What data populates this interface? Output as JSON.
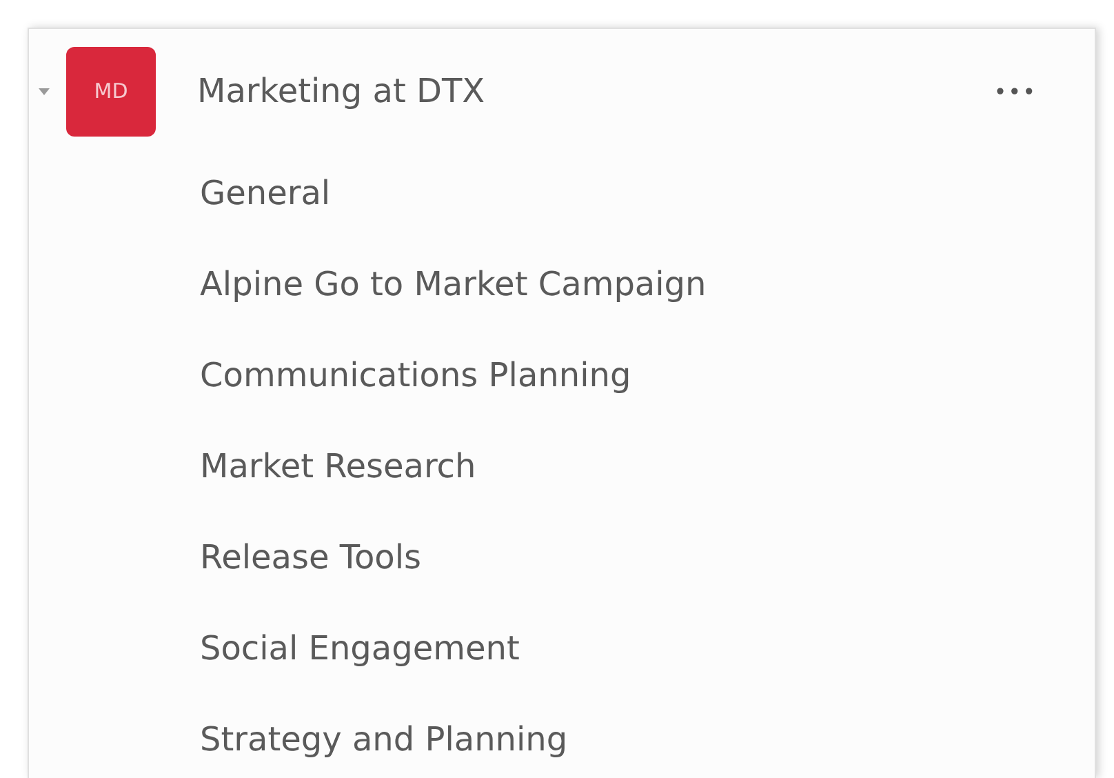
{
  "team": {
    "initials": "MD",
    "name": "Marketing at DTX",
    "expanded": true,
    "more": "•••",
    "color": "#d9283c"
  },
  "channels": [
    {
      "name": "General"
    },
    {
      "name": "Alpine Go to Market Campaign"
    },
    {
      "name": "Communications Planning"
    },
    {
      "name": "Market Research"
    },
    {
      "name": "Release Tools"
    },
    {
      "name": "Social Engagement"
    },
    {
      "name": "Strategy and Planning"
    }
  ]
}
